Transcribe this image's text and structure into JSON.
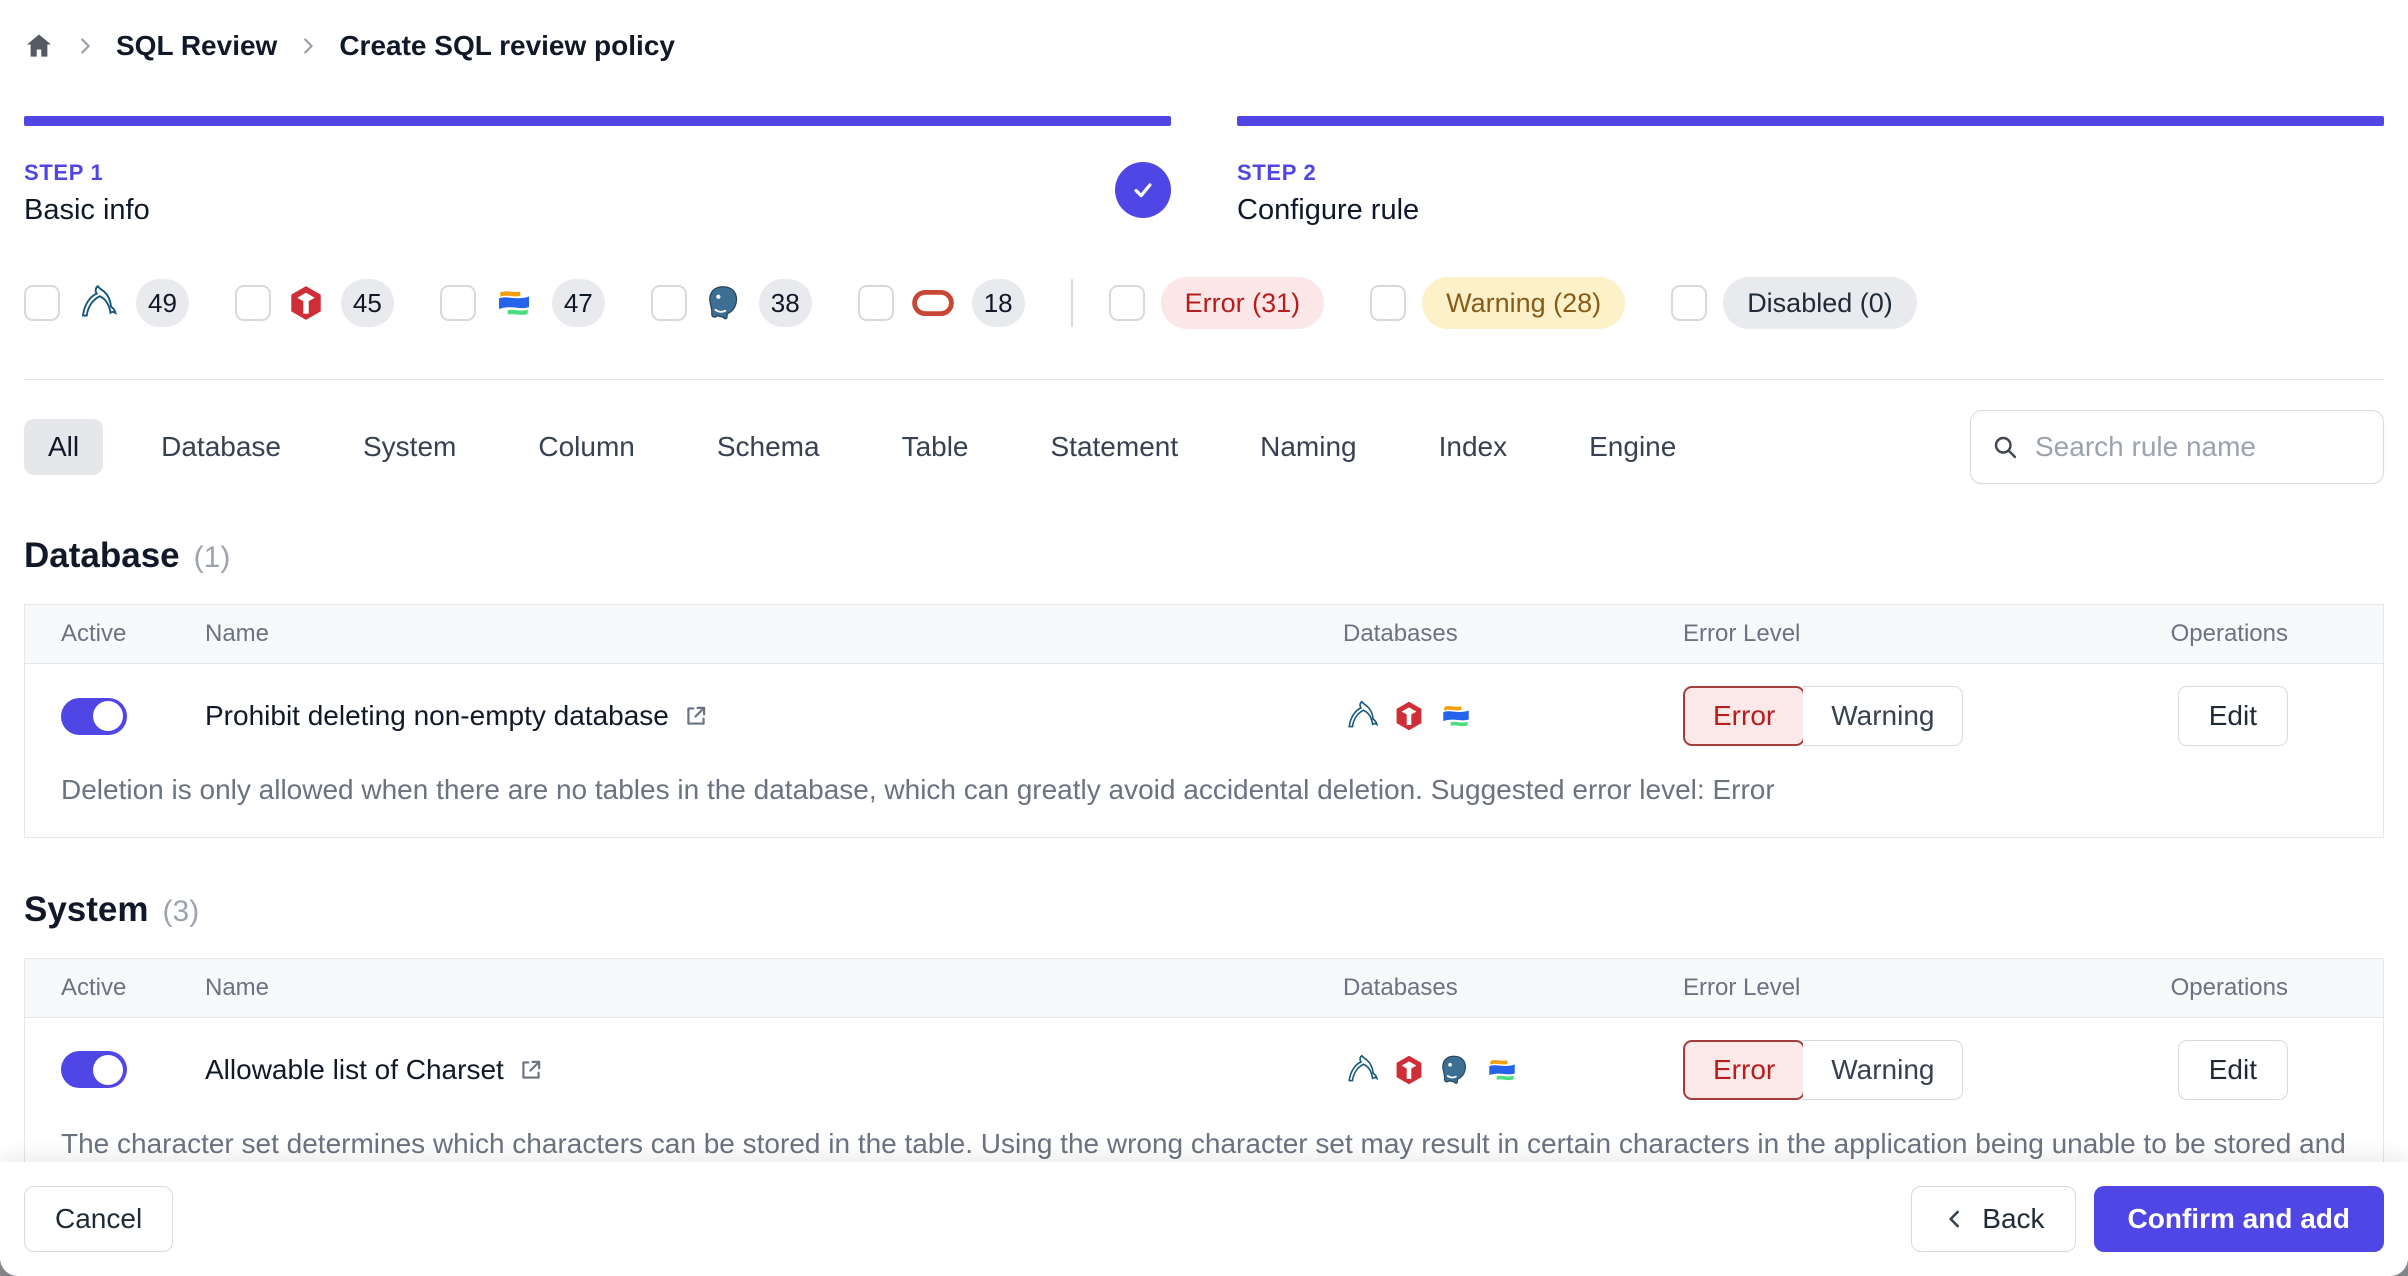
{
  "breadcrumb": {
    "items": [
      "SQL Review",
      "Create SQL review policy"
    ]
  },
  "steps": [
    {
      "label": "STEP 1",
      "title": "Basic info",
      "completed": true
    },
    {
      "label": "STEP 2",
      "title": "Configure rule",
      "completed": false
    }
  ],
  "filters": {
    "engines": [
      {
        "name": "mysql",
        "count": "49",
        "checked": false
      },
      {
        "name": "tidb",
        "count": "45",
        "checked": false
      },
      {
        "name": "oceanbase",
        "count": "47",
        "checked": false
      },
      {
        "name": "postgresql",
        "count": "38",
        "checked": false
      },
      {
        "name": "oracle",
        "count": "18",
        "checked": false
      }
    ],
    "levels": [
      {
        "type": "error",
        "label": "Error (31)",
        "checked": false
      },
      {
        "type": "warning",
        "label": "Warning (28)",
        "checked": false
      },
      {
        "type": "disabled",
        "label": "Disabled (0)",
        "checked": false
      }
    ]
  },
  "tabs": [
    "All",
    "Database",
    "System",
    "Column",
    "Schema",
    "Table",
    "Statement",
    "Naming",
    "Index",
    "Engine"
  ],
  "active_tab": "All",
  "search": {
    "placeholder": "Search rule name",
    "value": ""
  },
  "error_level_options": [
    "Error",
    "Warning"
  ],
  "buttons": {
    "edit": "Edit"
  },
  "sections": [
    {
      "title": "Database",
      "count": "(1)",
      "columns": [
        "Active",
        "Name",
        "Databases",
        "Error Level",
        "Operations"
      ],
      "rows": [
        {
          "name": "Prohibit deleting non-empty database",
          "active": true,
          "engines": [
            "mysql",
            "tidb",
            "oceanbase"
          ],
          "level": "Error",
          "description": "Deletion is only allowed when there are no tables in the database, which can greatly avoid accidental deletion. Suggested error level: Error"
        }
      ]
    },
    {
      "title": "System",
      "count": "(3)",
      "columns": [
        "Active",
        "Name",
        "Databases",
        "Error Level",
        "Operations"
      ],
      "rows": [
        {
          "name": "Allowable list of Charset",
          "active": true,
          "engines": [
            "mysql",
            "tidb",
            "postgresql",
            "oceanbase"
          ],
          "level": "Error",
          "description": "The character set determines which characters can be stored in the table. Using the wrong character set may result in certain characters in the application being unable to be stored and displayed correctly, such as CJK and Emoji. Suggested error level: Error"
        }
      ]
    }
  ],
  "footer": {
    "cancel": "Cancel",
    "back": "Back",
    "confirm": "Confirm and add"
  },
  "colors": {
    "accent": "#4f46e5",
    "error_text": "#b91c1c",
    "error_bg": "#fbe7e7",
    "warning_text": "#8a5a17",
    "warning_bg": "#fcf1c9",
    "disabled_bg": "#e8eaee"
  }
}
